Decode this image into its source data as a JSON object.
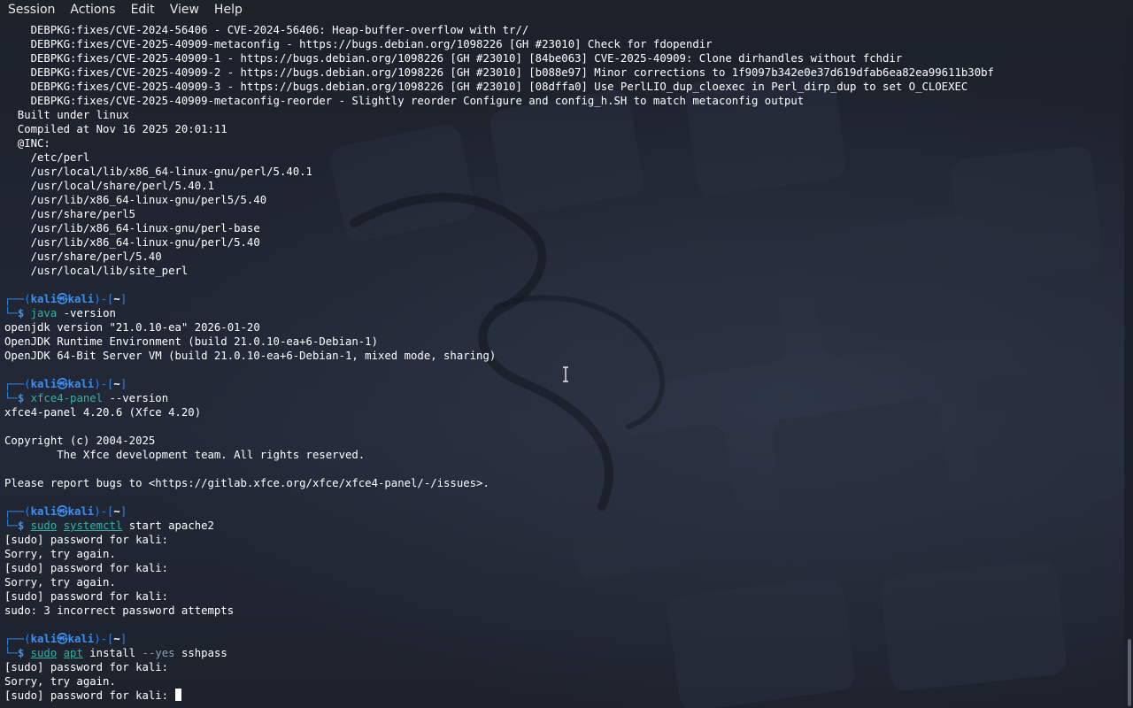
{
  "menubar": {
    "items": [
      "Session",
      "Actions",
      "Edit",
      "View",
      "Help"
    ]
  },
  "terminal": {
    "lines_top": [
      "    DEBPKG:fixes/CVE-2024-56406 - CVE-2024-56406: Heap-buffer-overflow with tr//",
      "    DEBPKG:fixes/CVE-2025-40909-metaconfig - https://bugs.debian.org/1098226 [GH #23010] Check for fdopendir",
      "    DEBPKG:fixes/CVE-2025-40909-1 - https://bugs.debian.org/1098226 [GH #23010] [84be063] CVE-2025-40909: Clone dirhandles without fchdir",
      "    DEBPKG:fixes/CVE-2025-40909-2 - https://bugs.debian.org/1098226 [GH #23010] [b088e97] Minor corrections to 1f9097b342e0e37d619dfab6ea82ea99611b30bf",
      "    DEBPKG:fixes/CVE-2025-40909-3 - https://bugs.debian.org/1098226 [GH #23010] [08dffa0] Use PerlLIO_dup_cloexec in Perl_dirp_dup to set O_CLOEXEC",
      "    DEBPKG:fixes/CVE-2025-40909-metaconfig-reorder - Slightly reorder Configure and config_h.SH to match metaconfig output",
      "  Built under linux",
      "  Compiled at Nov 16 2025 20:01:11",
      "  @INC:",
      "    /etc/perl",
      "    /usr/local/lib/x86_64-linux-gnu/perl/5.40.1",
      "    /usr/local/share/perl/5.40.1",
      "    /usr/lib/x86_64-linux-gnu/perl5/5.40",
      "    /usr/share/perl5",
      "    /usr/lib/x86_64-linux-gnu/perl-base",
      "    /usr/lib/x86_64-linux-gnu/perl/5.40",
      "    /usr/share/perl/5.40",
      "    /usr/local/lib/site_perl"
    ],
    "prompt": {
      "user": "kali",
      "host": "kali",
      "at": "㉿",
      "dir": "~",
      "dollar": "$"
    },
    "block1": {
      "cmd": "java",
      "args": " -version",
      "output": [
        "openjdk version \"21.0.10-ea\" 2026-01-20",
        "OpenJDK Runtime Environment (build 21.0.10-ea+6-Debian-1)",
        "OpenJDK 64-Bit Server VM (build 21.0.10-ea+6-Debian-1, mixed mode, sharing)"
      ]
    },
    "block2": {
      "cmd": "xfce4-panel",
      "args": " --version",
      "output": [
        "xfce4-panel 4.20.6 (Xfce 4.20)",
        "",
        "Copyright (c) 2004-2025",
        "        The Xfce development team. All rights reserved.",
        "",
        "Please report bugs to <https://gitlab.xfce.org/xfce/xfce4-panel/-/issues>."
      ]
    },
    "block3": {
      "sudo": "sudo",
      "cmd": "systemctl",
      "args": " start apache2",
      "output": [
        "[sudo] password for kali:",
        "Sorry, try again.",
        "[sudo] password for kali:",
        "Sorry, try again.",
        "[sudo] password for kali:",
        "sudo: 3 incorrect password attempts"
      ]
    },
    "block4": {
      "sudo": "sudo",
      "cmd": "apt",
      "args": " install ",
      "opt": "--yes",
      "args2": " sshpass",
      "output": [
        "[sudo] password for kali:",
        "Sorry, try again."
      ],
      "last_line": "[sudo] password for kali: "
    }
  }
}
